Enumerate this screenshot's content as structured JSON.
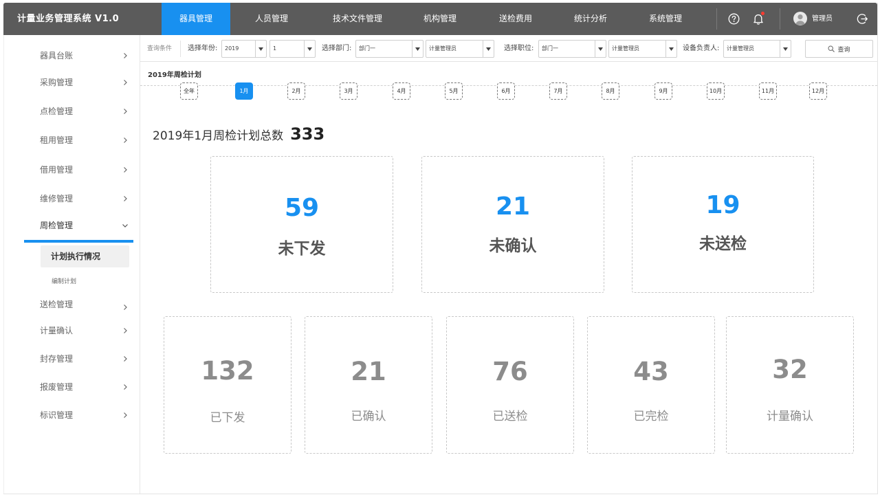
{
  "app": {
    "title": "计量业务管理系统 V1.0"
  },
  "nav": {
    "items": [
      {
        "label": "器具管理",
        "active": true
      },
      {
        "label": "人员管理"
      },
      {
        "label": "技术文件管理"
      },
      {
        "label": "机构管理"
      },
      {
        "label": "送检费用"
      },
      {
        "label": "统计分析"
      },
      {
        "label": "系统管理"
      }
    ]
  },
  "user": {
    "name": "管理员"
  },
  "icons": {
    "help": "help-circle-icon",
    "bell": "bell-icon",
    "avatar": "user-avatar-icon",
    "logout": "logout-icon",
    "chevron": "chevron-right-icon",
    "search": "search-icon"
  },
  "colors": {
    "accent": "#1890f0",
    "topbar": "#5b5b5b",
    "notify": "#ff3b30"
  },
  "sidebar": {
    "items": [
      {
        "label": "器具台账"
      },
      {
        "label": "采购管理"
      },
      {
        "label": "点检管理"
      },
      {
        "label": "租用管理"
      },
      {
        "label": "借用管理"
      },
      {
        "label": "维修管理"
      },
      {
        "label": "周检管理",
        "open": true
      },
      {
        "label": "送检管理"
      },
      {
        "label": "计量确认"
      },
      {
        "label": "封存管理"
      },
      {
        "label": "报废管理"
      },
      {
        "label": "标识管理"
      }
    ],
    "sub_active": "计划执行情况",
    "sub_other": "编制计划"
  },
  "filters": {
    "caption": "查询条件",
    "year_label": "选择年份:",
    "year_value": "2019",
    "month_value": "1",
    "dept_label": "选择部门:",
    "dept_value": "部门一",
    "dept_manager_value": "计量管理员",
    "post_label": "选择职位:",
    "post_value": "部门一",
    "post_manager_value": "计量管理员",
    "owner_label": "设备负责人:",
    "owner_value": "计量管理员",
    "query_label": "查询"
  },
  "plan": {
    "title": "2019年周检计划",
    "months": [
      "全年",
      "1月",
      "2月",
      "3月",
      "4月",
      "5月",
      "6月",
      "7月",
      "8月",
      "9月",
      "10月",
      "11月",
      "12月"
    ],
    "active_month": "1月"
  },
  "summary": {
    "total_label": "2019年1月周检计划总数",
    "total_value": "333",
    "primary": [
      {
        "value": "59",
        "label": "未下发"
      },
      {
        "value": "21",
        "label": "未确认"
      },
      {
        "value": "19",
        "label": "未送检"
      }
    ],
    "secondary": [
      {
        "value": "132",
        "label": "已下发"
      },
      {
        "value": "21",
        "label": "已确认"
      },
      {
        "value": "76",
        "label": "已送检"
      },
      {
        "value": "43",
        "label": "已完检"
      },
      {
        "value": "32",
        "label": "计量确认"
      }
    ]
  }
}
